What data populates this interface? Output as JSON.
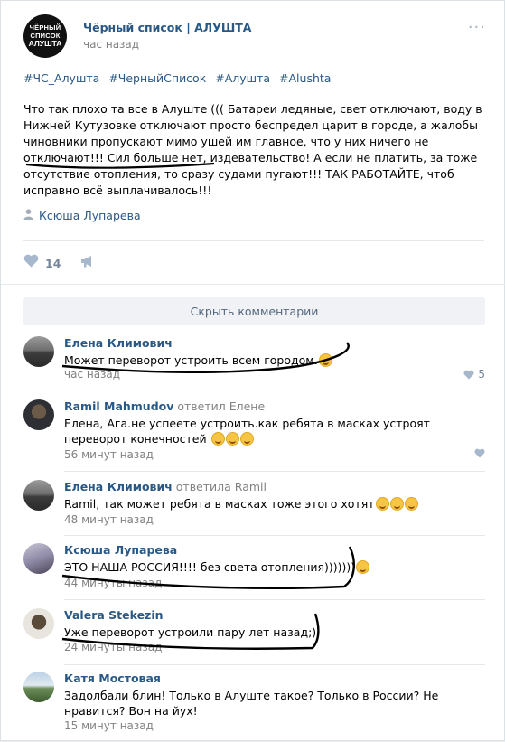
{
  "post": {
    "logo_lines": [
      "ЧЁРНЫЙ",
      "СПИСОК",
      "АЛУШТА"
    ],
    "group_name": "Чёрный список | АЛУШТА",
    "time": "час назад",
    "hashtags": [
      "#ЧС_Алушта",
      "#ЧерныйСписок",
      "#Алушта",
      "#Alushta"
    ],
    "text": "Что так плохо та все в Алуште ((( Батареи ледяные, свет отключают, воду в Нижней Кутузовке отключают просто беспредел царит в городе, а жалобы чиновники пропускают мимо ушей им главное, что у них ничего не отключают!!! Сил больше нет, издевательство! А если не платить, за тоже отсутствие отопления, то сразу судами пугают!!! ТАК РАБОТАЙТЕ, чтоб исправно всё выплачивалось!!!",
    "signer": "Ксюша Лупарева",
    "likes": "14",
    "icons": {
      "more": "more-dots-icon",
      "like": "heart-icon",
      "share": "megaphone-icon",
      "signer": "person-icon"
    }
  },
  "hide_comments_label": "Скрыть комментарии",
  "comments": [
    {
      "author": "Елена Климович",
      "replied": "",
      "text": "Может переворот устроить всем городом.",
      "time": "час назад",
      "likes": "5"
    },
    {
      "author": "Ramil Mahmudov",
      "replied": "ответил Елене",
      "text": "Елена, Ага.не успеете устроить.как ребята в масках устроят переворот конечностей",
      "time": "56 минут назад",
      "likes": ""
    },
    {
      "author": "Елена Климович",
      "replied": "ответила Ramil",
      "text": "Ramil, так может ребята в масках тоже этого хотят",
      "time": "48 минут назад",
      "likes": ""
    },
    {
      "author": "Ксюша Лупарева",
      "replied": "",
      "text": "ЭТО НАША РОССИЯ!!!! без света отопления)))))))",
      "time": "44 минуты назад",
      "likes": ""
    },
    {
      "author": "Valera Stekezin",
      "replied": "",
      "text": "Уже переворот устроили пару лет назад;)",
      "time": "24 минуты назад",
      "likes": ""
    },
    {
      "author": "Катя Мостовая",
      "replied": "",
      "text": "Задолбали блин! Только в Алуште такое? Только в России? Не нравится? Вон на йух!",
      "time": "15 минут назад",
      "likes": ""
    }
  ],
  "colors": {
    "link": "#2a5885",
    "meta": "#828282",
    "scribble": "#000000"
  }
}
